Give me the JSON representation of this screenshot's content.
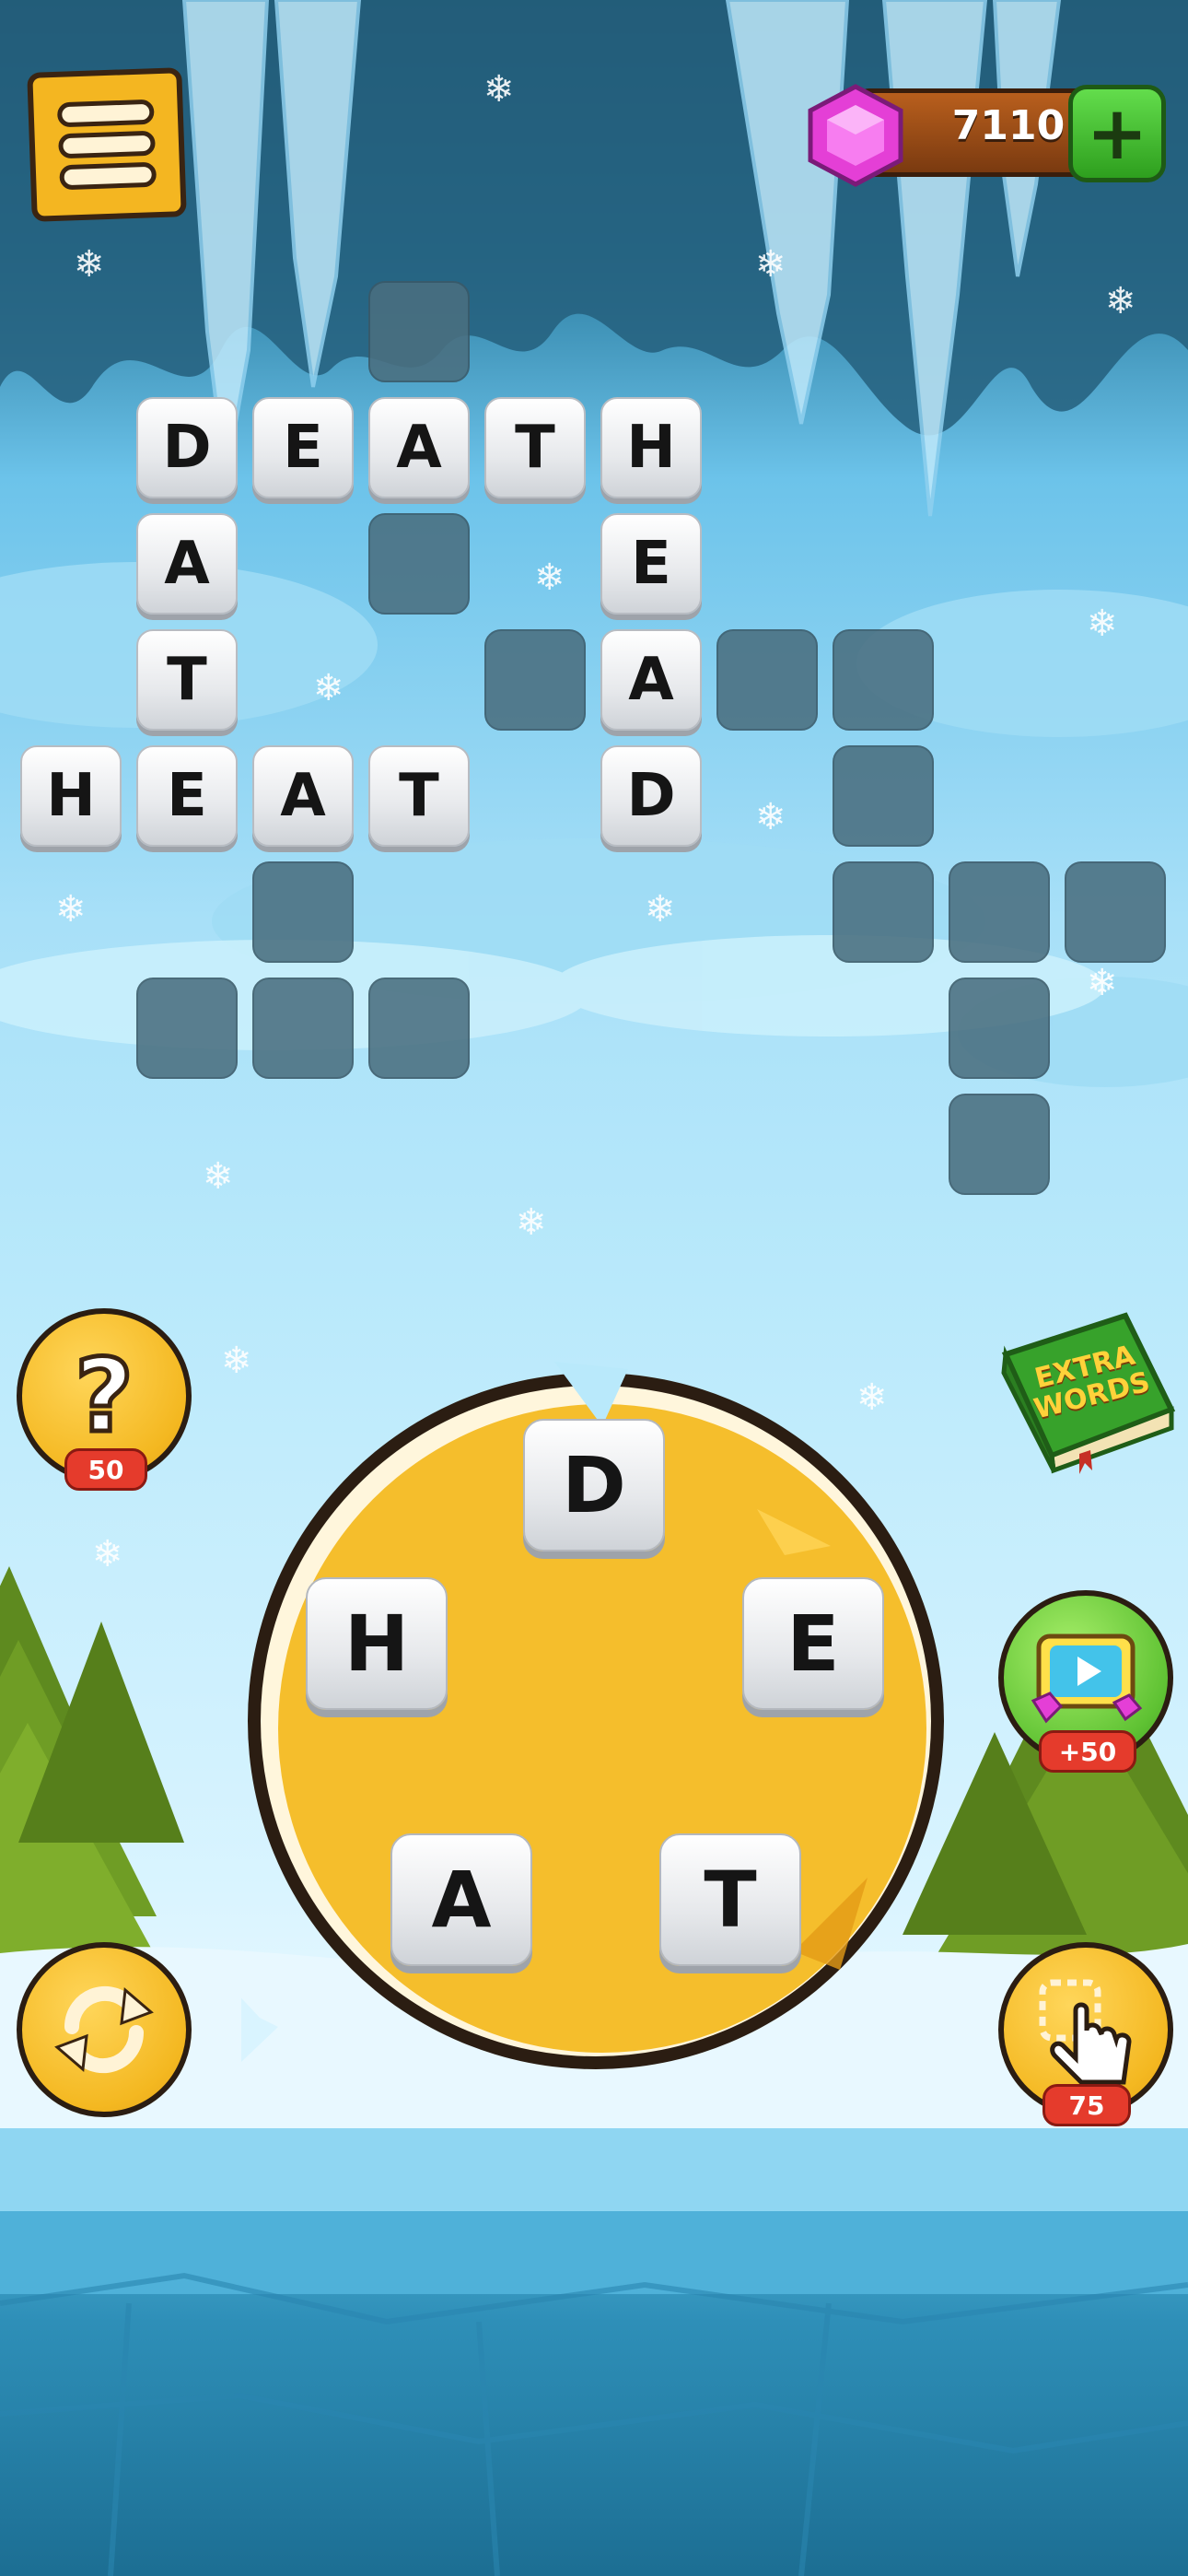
{
  "currency": {
    "gems": "7110",
    "plus": "+"
  },
  "grid": {
    "rows": [
      [
        "D",
        "E",
        "A",
        "T",
        "H"
      ],
      [
        "A",
        "E"
      ],
      [
        "T",
        "A"
      ],
      [
        "H",
        "E",
        "A",
        "T",
        "D"
      ]
    ]
  },
  "wheel": {
    "letters": [
      "D",
      "H",
      "E",
      "A",
      "T"
    ]
  },
  "hint": {
    "symbol": "?",
    "cost": "50"
  },
  "extra_words": {
    "line1": "EXTRA",
    "line2": "WORDS"
  },
  "video": {
    "reward": "+50"
  },
  "finger_hint": {
    "cost": "75"
  },
  "colors": {
    "accent": "#f4b821",
    "gem": "#e43fd6",
    "plus": "#3fc23a",
    "badge": "#e53b2c"
  }
}
